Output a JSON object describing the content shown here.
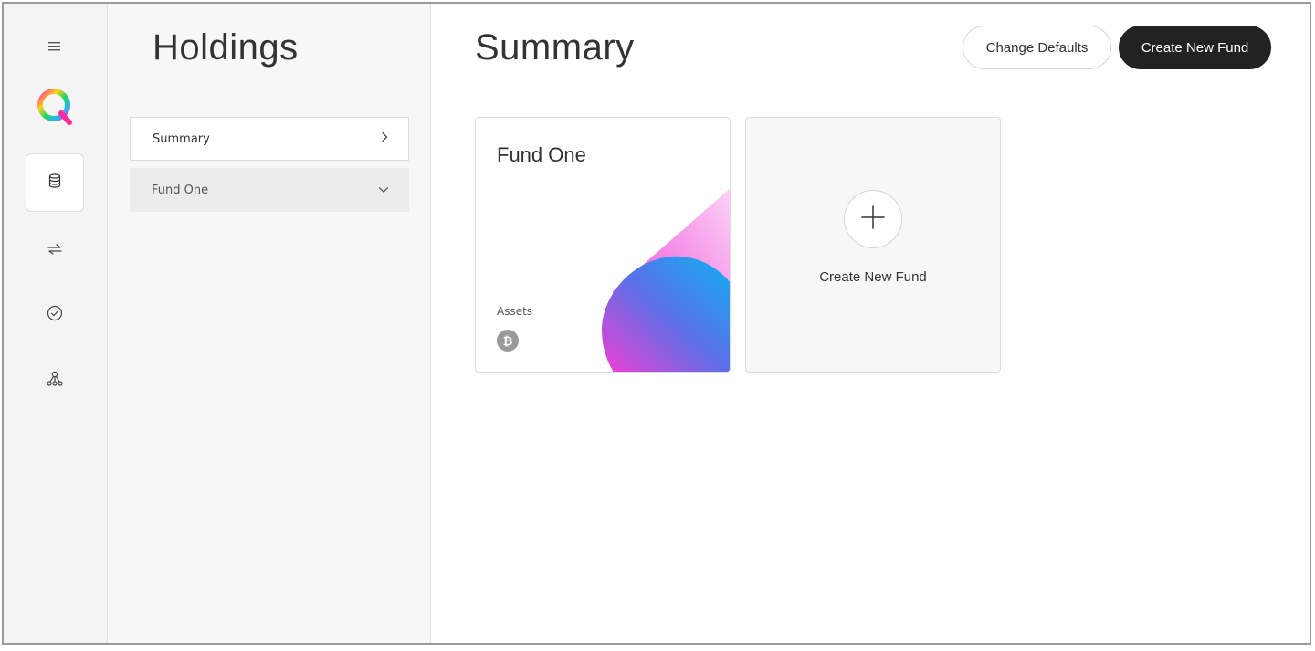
{
  "sidebar": {
    "icons": [
      "menu-icon",
      "quantum-logo",
      "database-icon",
      "transfer-arrows-icon",
      "check-circle-icon",
      "network-icon"
    ]
  },
  "panel": {
    "title": "Holdings",
    "items": [
      {
        "label": "Summary",
        "icon": "chevron-right-icon"
      },
      {
        "label": "Fund One",
        "icon": "chevron-down-icon"
      }
    ]
  },
  "main": {
    "title": "Summary",
    "change_defaults_label": "Change Defaults",
    "create_fund_label": "Create New Fund",
    "fund_card": {
      "title": "Fund One",
      "assets_label": "Assets",
      "asset_icon": "bitcoin-icon"
    },
    "new_fund_card_label": "Create New Fund"
  },
  "colors": {
    "primary_button": "#222222",
    "rail_bg": "#f4f4f4",
    "gradient_blue": "#10a8f2",
    "gradient_pink": "#f044d8",
    "gradient_light_pink": "#f9c6f2",
    "bitcoin_gray": "#9a9a9a"
  }
}
